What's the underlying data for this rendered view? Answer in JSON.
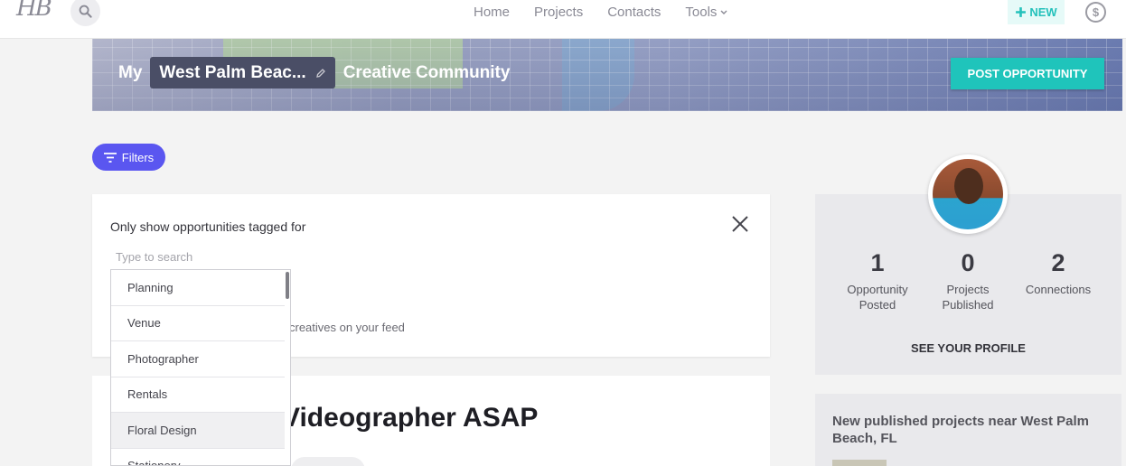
{
  "nav": {
    "logo": "HB",
    "links": [
      "Home",
      "Projects",
      "Contacts",
      "Tools"
    ],
    "new_label": "NEW",
    "new_icon": "plus-icon",
    "dollar_icon": "dollar-circle-icon"
  },
  "banner": {
    "prefix": "My",
    "city": "West Palm Beac...",
    "suffix": "Creative Community",
    "post_button": "POST OPPORTUNITY"
  },
  "filters": {
    "button_label": "Filters",
    "heading": "Only show opportunities tagged for",
    "search_placeholder": "Type to search",
    "feed_note": "creatives on your feed",
    "options": [
      "Planning",
      "Venue",
      "Photographer",
      "Rentals",
      "Floral Design",
      "Stationery"
    ]
  },
  "opportunity": {
    "title": "Videographer ASAP"
  },
  "profile": {
    "stats": [
      {
        "value": "1",
        "label_line1": "Opportunity",
        "label_line2": "Posted"
      },
      {
        "value": "0",
        "label_line1": "Projects",
        "label_line2": "Published"
      },
      {
        "value": "2",
        "label_line1": "Connections",
        "label_line2": ""
      }
    ],
    "see_profile": "SEE YOUR PROFILE"
  },
  "nearby": {
    "title": "New published projects near West Palm Beach, FL"
  },
  "colors": {
    "accent_teal": "#1fc4bb",
    "filters_purple": "#5a56f0"
  }
}
